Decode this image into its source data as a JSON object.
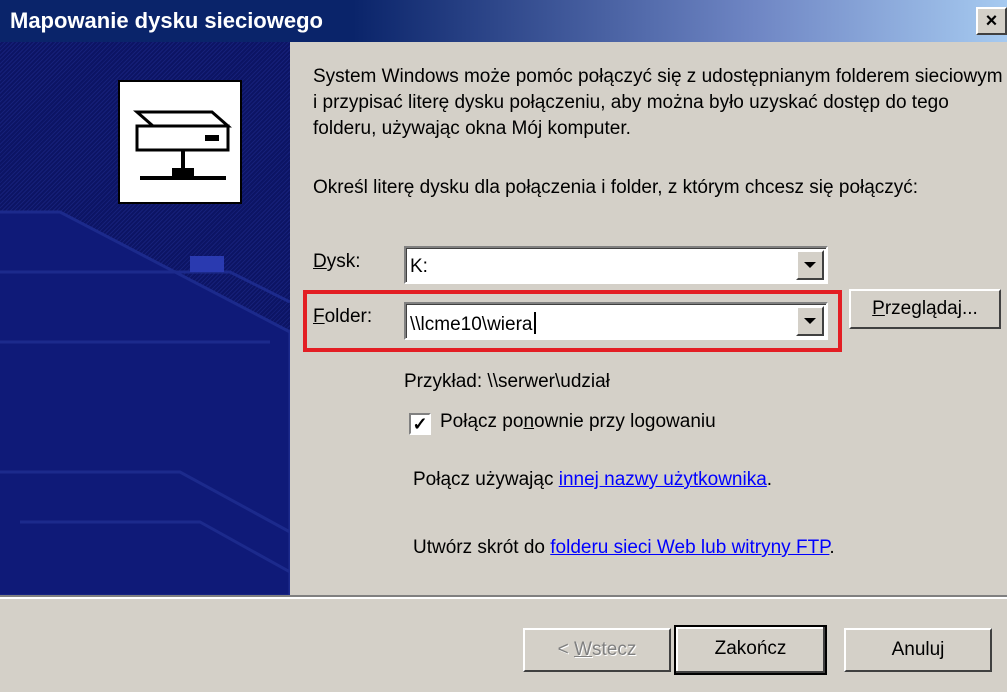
{
  "window": {
    "title": "Mapowanie dysku sieciowego",
    "close_symbol": "×"
  },
  "description": "System Windows może pomóc połączyć się z udostępnianym folderem sieciowym i przypisać literę dysku połączeniu, aby można było uzyskać dostęp do tego folderu, używając okna Mój komputer.",
  "instruction": "Określ literę dysku dla połączenia i folder, z którym chcesz się połączyć:",
  "drive": {
    "label_mnemonic": "D",
    "label_rest": "ysk:",
    "value": "K:"
  },
  "folder": {
    "label_mnemonic": "F",
    "label_rest": "older:",
    "value": "\\\\lcme10\\wiera"
  },
  "browse_button": {
    "pre": "",
    "mnemonic": "P",
    "post": "rzeglądaj..."
  },
  "example": "Przykład: \\\\serwer\\udział",
  "reconnect": {
    "checked": true,
    "check_symbol": "✓",
    "pre": "Połącz po",
    "mnemonic": "n",
    "post": "ownie przy logowaniu"
  },
  "other_user": {
    "prefix": "Połącz używając ",
    "link": "innej nazwy użytkownika",
    "suffix": "."
  },
  "shortcut": {
    "prefix": "Utwórz skrót do ",
    "link": "folderu sieci Web lub witryny FTP",
    "suffix": "."
  },
  "buttons": {
    "back_pre": "< ",
    "back_mnemonic": "W",
    "back_post": "stecz",
    "finish": "Zakończ",
    "cancel": "Anuluj"
  },
  "colors": {
    "title_bar": "#0a246a",
    "sidebar": "#0c1464",
    "highlight": "#e31e24",
    "link": "#0000ff"
  }
}
